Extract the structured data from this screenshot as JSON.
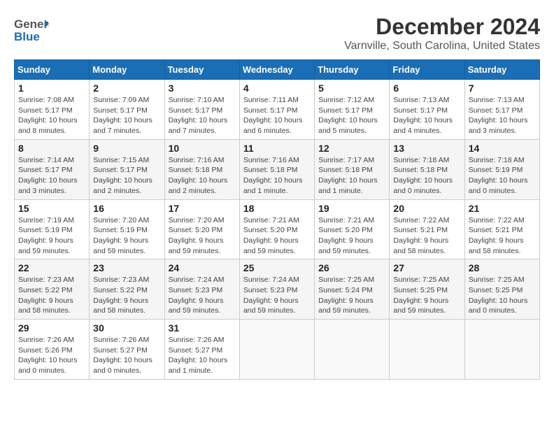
{
  "header": {
    "logo_general": "General",
    "logo_blue": "Blue",
    "title": "December 2024",
    "subtitle": "Varnville, South Carolina, United States"
  },
  "days_of_week": [
    "Sunday",
    "Monday",
    "Tuesday",
    "Wednesday",
    "Thursday",
    "Friday",
    "Saturday"
  ],
  "weeks": [
    [
      {
        "day": "1",
        "sunrise": "Sunrise: 7:08 AM",
        "sunset": "Sunset: 5:17 PM",
        "daylight": "Daylight: 10 hours and 8 minutes."
      },
      {
        "day": "2",
        "sunrise": "Sunrise: 7:09 AM",
        "sunset": "Sunset: 5:17 PM",
        "daylight": "Daylight: 10 hours and 7 minutes."
      },
      {
        "day": "3",
        "sunrise": "Sunrise: 7:10 AM",
        "sunset": "Sunset: 5:17 PM",
        "daylight": "Daylight: 10 hours and 7 minutes."
      },
      {
        "day": "4",
        "sunrise": "Sunrise: 7:11 AM",
        "sunset": "Sunset: 5:17 PM",
        "daylight": "Daylight: 10 hours and 6 minutes."
      },
      {
        "day": "5",
        "sunrise": "Sunrise: 7:12 AM",
        "sunset": "Sunset: 5:17 PM",
        "daylight": "Daylight: 10 hours and 5 minutes."
      },
      {
        "day": "6",
        "sunrise": "Sunrise: 7:13 AM",
        "sunset": "Sunset: 5:17 PM",
        "daylight": "Daylight: 10 hours and 4 minutes."
      },
      {
        "day": "7",
        "sunrise": "Sunrise: 7:13 AM",
        "sunset": "Sunset: 5:17 PM",
        "daylight": "Daylight: 10 hours and 3 minutes."
      }
    ],
    [
      {
        "day": "8",
        "sunrise": "Sunrise: 7:14 AM",
        "sunset": "Sunset: 5:17 PM",
        "daylight": "Daylight: 10 hours and 3 minutes."
      },
      {
        "day": "9",
        "sunrise": "Sunrise: 7:15 AM",
        "sunset": "Sunset: 5:17 PM",
        "daylight": "Daylight: 10 hours and 2 minutes."
      },
      {
        "day": "10",
        "sunrise": "Sunrise: 7:16 AM",
        "sunset": "Sunset: 5:18 PM",
        "daylight": "Daylight: 10 hours and 2 minutes."
      },
      {
        "day": "11",
        "sunrise": "Sunrise: 7:16 AM",
        "sunset": "Sunset: 5:18 PM",
        "daylight": "Daylight: 10 hours and 1 minute."
      },
      {
        "day": "12",
        "sunrise": "Sunrise: 7:17 AM",
        "sunset": "Sunset: 5:18 PM",
        "daylight": "Daylight: 10 hours and 1 minute."
      },
      {
        "day": "13",
        "sunrise": "Sunrise: 7:18 AM",
        "sunset": "Sunset: 5:18 PM",
        "daylight": "Daylight: 10 hours and 0 minutes."
      },
      {
        "day": "14",
        "sunrise": "Sunrise: 7:18 AM",
        "sunset": "Sunset: 5:19 PM",
        "daylight": "Daylight: 10 hours and 0 minutes."
      }
    ],
    [
      {
        "day": "15",
        "sunrise": "Sunrise: 7:19 AM",
        "sunset": "Sunset: 5:19 PM",
        "daylight": "Daylight: 9 hours and 59 minutes."
      },
      {
        "day": "16",
        "sunrise": "Sunrise: 7:20 AM",
        "sunset": "Sunset: 5:19 PM",
        "daylight": "Daylight: 9 hours and 59 minutes."
      },
      {
        "day": "17",
        "sunrise": "Sunrise: 7:20 AM",
        "sunset": "Sunset: 5:20 PM",
        "daylight": "Daylight: 9 hours and 59 minutes."
      },
      {
        "day": "18",
        "sunrise": "Sunrise: 7:21 AM",
        "sunset": "Sunset: 5:20 PM",
        "daylight": "Daylight: 9 hours and 59 minutes."
      },
      {
        "day": "19",
        "sunrise": "Sunrise: 7:21 AM",
        "sunset": "Sunset: 5:20 PM",
        "daylight": "Daylight: 9 hours and 59 minutes."
      },
      {
        "day": "20",
        "sunrise": "Sunrise: 7:22 AM",
        "sunset": "Sunset: 5:21 PM",
        "daylight": "Daylight: 9 hours and 58 minutes."
      },
      {
        "day": "21",
        "sunrise": "Sunrise: 7:22 AM",
        "sunset": "Sunset: 5:21 PM",
        "daylight": "Daylight: 9 hours and 58 minutes."
      }
    ],
    [
      {
        "day": "22",
        "sunrise": "Sunrise: 7:23 AM",
        "sunset": "Sunset: 5:22 PM",
        "daylight": "Daylight: 9 hours and 58 minutes."
      },
      {
        "day": "23",
        "sunrise": "Sunrise: 7:23 AM",
        "sunset": "Sunset: 5:22 PM",
        "daylight": "Daylight: 9 hours and 58 minutes."
      },
      {
        "day": "24",
        "sunrise": "Sunrise: 7:24 AM",
        "sunset": "Sunset: 5:23 PM",
        "daylight": "Daylight: 9 hours and 59 minutes."
      },
      {
        "day": "25",
        "sunrise": "Sunrise: 7:24 AM",
        "sunset": "Sunset: 5:23 PM",
        "daylight": "Daylight: 9 hours and 59 minutes."
      },
      {
        "day": "26",
        "sunrise": "Sunrise: 7:25 AM",
        "sunset": "Sunset: 5:24 PM",
        "daylight": "Daylight: 9 hours and 59 minutes."
      },
      {
        "day": "27",
        "sunrise": "Sunrise: 7:25 AM",
        "sunset": "Sunset: 5:25 PM",
        "daylight": "Daylight: 9 hours and 59 minutes."
      },
      {
        "day": "28",
        "sunrise": "Sunrise: 7:25 AM",
        "sunset": "Sunset: 5:25 PM",
        "daylight": "Daylight: 10 hours and 0 minutes."
      }
    ],
    [
      {
        "day": "29",
        "sunrise": "Sunrise: 7:26 AM",
        "sunset": "Sunset: 5:26 PM",
        "daylight": "Daylight: 10 hours and 0 minutes."
      },
      {
        "day": "30",
        "sunrise": "Sunrise: 7:26 AM",
        "sunset": "Sunset: 5:27 PM",
        "daylight": "Daylight: 10 hours and 0 minutes."
      },
      {
        "day": "31",
        "sunrise": "Sunrise: 7:26 AM",
        "sunset": "Sunset: 5:27 PM",
        "daylight": "Daylight: 10 hours and 1 minute."
      },
      null,
      null,
      null,
      null
    ]
  ]
}
